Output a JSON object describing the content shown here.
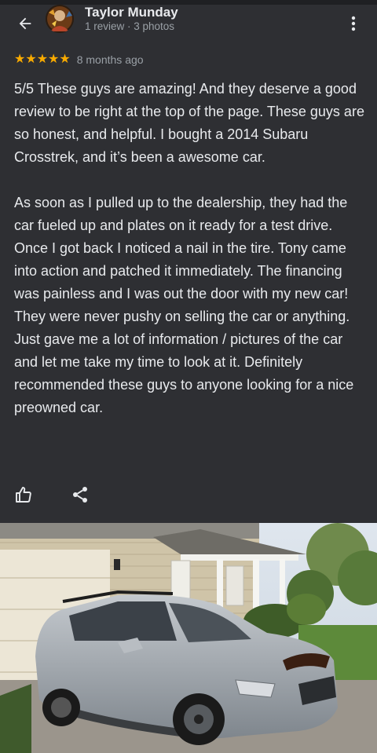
{
  "header": {
    "reviewer_name": "Taylor Munday",
    "reviewer_meta": "1 review · 3 photos",
    "back_icon": "arrow-left-icon",
    "more_icon": "more-vert-icon"
  },
  "review": {
    "rating": 5,
    "rating_max": 5,
    "stars": "★★★★★",
    "date": "8 months ago",
    "paragraphs": [
      "5/5 These guys are amazing! And they deserve a good review to be right at the top of the page. These guys are so honest, and helpful. I bought a 2014 Subaru Crosstrek, and it’s been a awesome car.",
      "As soon as I pulled up to the dealership, they had the car fueled up and plates on it ready for a test drive. Once I got back I noticed a nail in the tire. Tony came into action and patched it immediately. The financing was painless and I was out the door with my new car! They were never pushy on selling the car or anything. Just gave me a lot of information / pictures of the car and let me take my time to look at it. Definitely recommended these guys to anyone looking for a nice preowned car."
    ]
  },
  "actions": {
    "like_icon": "thumb-up-icon",
    "share_icon": "share-icon"
  },
  "colors": {
    "background": "#2e2f33",
    "star": "#f9ab00",
    "secondary_text": "#9aa0a6",
    "primary_text": "#e8eaed"
  }
}
